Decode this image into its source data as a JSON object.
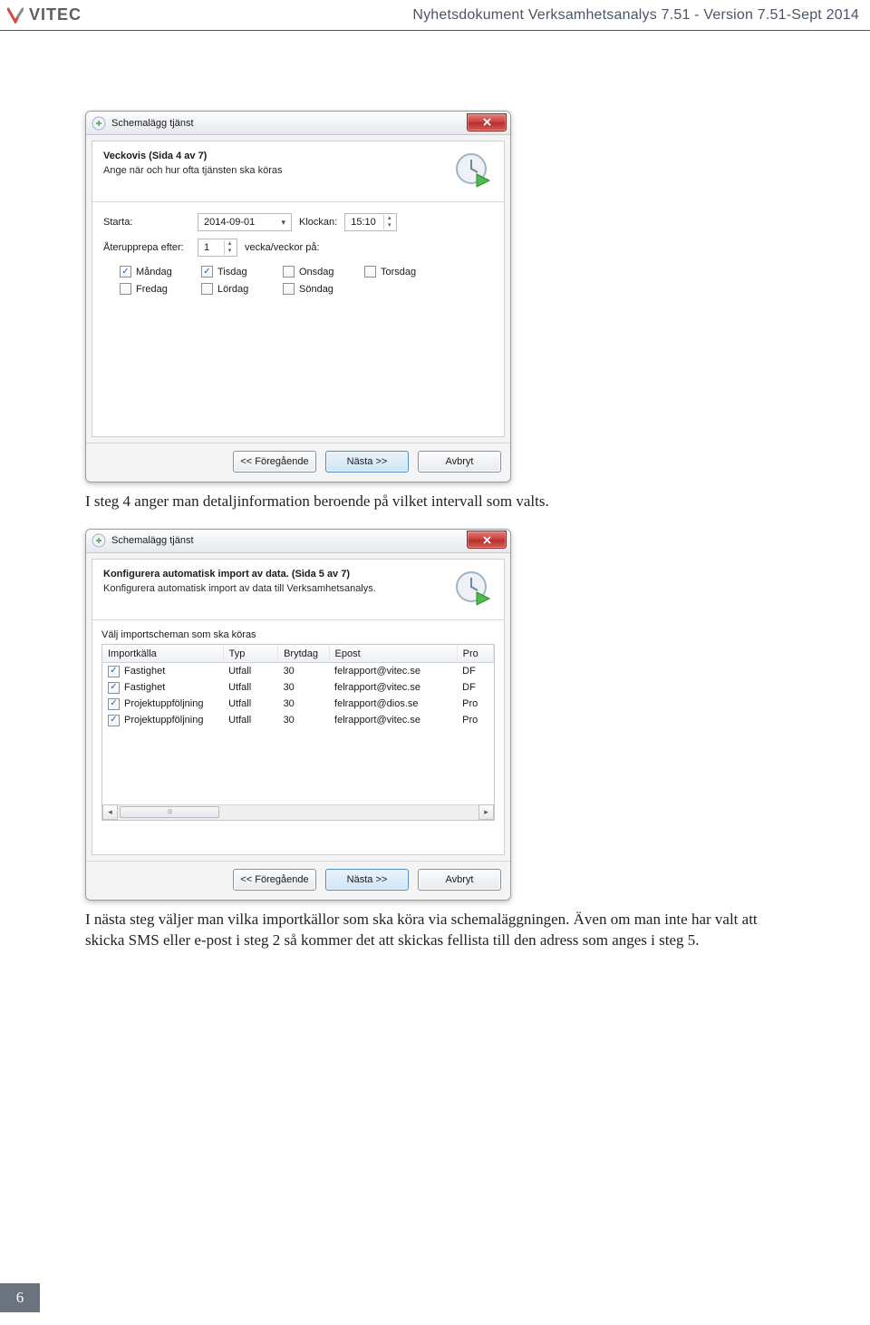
{
  "header": {
    "brand": "VITEC",
    "title": "Nyhetsdokument Verksamhetsanalys 7.51 - Version 7.51-Sept 2014"
  },
  "dialog1": {
    "window_title": "Schemalägg tjänst",
    "hdr_title": "Veckovis (Sida 4 av 7)",
    "hdr_sub": "Ange när och hur ofta tjänsten ska köras",
    "starta_label": "Starta:",
    "date_value": "2014-09-01",
    "klockan_label": "Klockan:",
    "time_value": "15:10",
    "aterupprepa_label": "Återupprepa efter:",
    "repeat_value": "1",
    "repeat_unit": "vecka/veckor på:",
    "days": {
      "mon": {
        "label": "Måndag",
        "checked": true
      },
      "tue": {
        "label": "Tisdag",
        "checked": true
      },
      "wed": {
        "label": "Onsdag",
        "checked": false
      },
      "thu": {
        "label": "Torsdag",
        "checked": false
      },
      "fri": {
        "label": "Fredag",
        "checked": false
      },
      "sat": {
        "label": "Lördag",
        "checked": false
      },
      "sun": {
        "label": "Söndag",
        "checked": false
      }
    },
    "btn_prev": "<< Föregående",
    "btn_next": "Nästa >>",
    "btn_cancel": "Avbryt"
  },
  "caption1": "I steg 4 anger man detaljinformation beroende på vilket intervall som valts.",
  "dialog2": {
    "window_title": "Schemalägg tjänst",
    "hdr_title": "Konfigurera automatisk import av data. (Sida 5 av 7)",
    "hdr_sub": "Konfigurera automatisk import av data till Verksamhetsanalys.",
    "table_caption": "Välj importscheman som ska köras",
    "cols": {
      "src": "Importkälla",
      "typ": "Typ",
      "brytdag": "Brytdag",
      "epost": "Epost",
      "pr": "Pro"
    },
    "rows": [
      {
        "checked": true,
        "src": "Fastighet",
        "typ": "Utfall",
        "brytdag": "30",
        "epost": "felrapport@vitec.se",
        "pr": "DF"
      },
      {
        "checked": true,
        "src": "Fastighet",
        "typ": "Utfall",
        "brytdag": "30",
        "epost": "felrapport@vitec.se",
        "pr": "DF"
      },
      {
        "checked": true,
        "src": "Projektuppföljning",
        "typ": "Utfall",
        "brytdag": "30",
        "epost": "felrapport@dios.se",
        "pr": "Pro"
      },
      {
        "checked": true,
        "src": "Projektuppföljning",
        "typ": "Utfall",
        "brytdag": "30",
        "epost": "felrapport@vitec.se",
        "pr": "Pro"
      }
    ],
    "btn_prev": "<< Föregående",
    "btn_next": "Nästa >>",
    "btn_cancel": "Avbryt"
  },
  "caption2": "I nästa steg väljer man vilka importkällor som ska köra via schemaläggningen. Även om man inte har valt att skicka SMS eller e-post i steg 2 så kommer det att skickas fellista till den adress som anges i steg 5.",
  "page_number": "6"
}
